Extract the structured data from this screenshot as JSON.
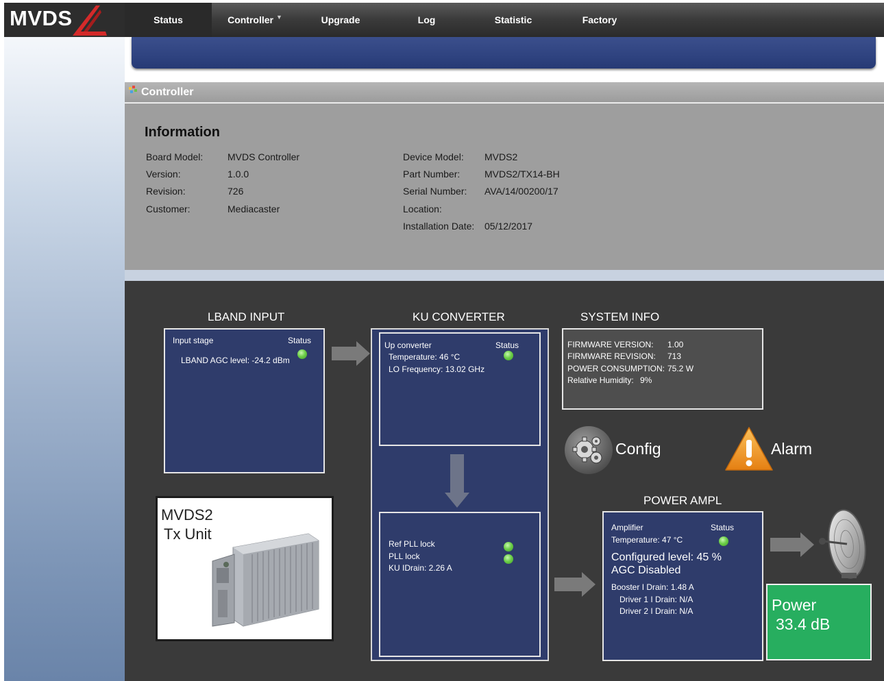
{
  "logo": {
    "text": "MVDS"
  },
  "nav": {
    "items": [
      {
        "label": "Status",
        "active": true
      },
      {
        "label": "Controller",
        "has_caret": true
      },
      {
        "label": "Upgrade"
      },
      {
        "label": "Log"
      },
      {
        "label": "Statistic"
      },
      {
        "label": "Factory"
      }
    ],
    "caret": "▼"
  },
  "controller": {
    "title": "Controller",
    "info_title": "Information",
    "left": [
      {
        "label": "Board Model:",
        "value": "MVDS Controller"
      },
      {
        "label": "Version:",
        "value": "1.0.0"
      },
      {
        "label": "Revision:",
        "value": "726"
      },
      {
        "label": "Customer:",
        "value": "Mediacaster"
      }
    ],
    "right": [
      {
        "label": "Device Model:",
        "value": "MVDS2"
      },
      {
        "label": "Part Number:",
        "value": "MVDS2/TX14-BH"
      },
      {
        "label": "Serial Number:",
        "value": "AVA/14/00200/17"
      },
      {
        "label": "Location:",
        "value": ""
      },
      {
        "label": "Installation Date:",
        "value": "05/12/2017"
      }
    ]
  },
  "lband": {
    "title": "LBAND INPUT",
    "stage": "Input stage",
    "status": "Status",
    "agc": "LBAND AGC level: -24.2 dBm"
  },
  "ku": {
    "title": "KU CONVERTER",
    "up_converter": "Up converter",
    "status": "Status",
    "temperature": "Temperature: 46 °C",
    "lo_freq": "LO Frequency: 13.02 GHz",
    "ref_pll": "Ref PLL lock",
    "pll": "PLL lock",
    "idrain": "KU IDrain: 2.26 A"
  },
  "system": {
    "title": "SYSTEM INFO",
    "rows": [
      {
        "label": "FIRMWARE VERSION:",
        "value": "1.00"
      },
      {
        "label": "FIRMWARE REVISION:",
        "value": "713"
      },
      {
        "label": "POWER CONSUMPTION:",
        "value": "75.2 W"
      },
      {
        "label": "Relative Humidity:",
        "value": "9%"
      }
    ]
  },
  "actions": {
    "config": "Config",
    "alarm": "Alarm"
  },
  "unit": {
    "line1": "MVDS2",
    "line2": "Tx Unit"
  },
  "power_ampl": {
    "title": "POWER AMPL",
    "amplifier": "Amplifier",
    "status": "Status",
    "temperature": "Temperature: 47 °C",
    "configured": "Configured level: 45 %",
    "agc": "AGC Disabled",
    "booster": "Booster I Drain: 1.48 A",
    "driver1": "Driver 1 I Drain: N/A",
    "driver2": "Driver 2 I Drain: N/A"
  },
  "power": {
    "label": "Power",
    "value": "33.4 dB"
  },
  "colors": {
    "accent_blue": "#2f3c6b",
    "status_green": "#6ed04a",
    "power_green": "#27ae5f",
    "alarm_orange": "#f29a1f"
  }
}
